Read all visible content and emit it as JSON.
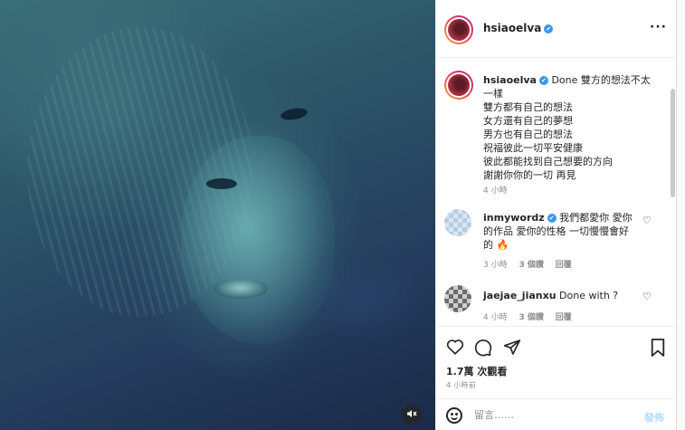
{
  "post": {
    "username": "hsiaoelva",
    "verified_mark": "✔",
    "more_label": "···"
  },
  "caption": {
    "username": "hsiaoelva",
    "first_line": "Done 雙方的想法不太一樣",
    "lines": [
      "雙方都有自己的想法",
      "女方還有自己的夢想",
      "男方也有自己的想法",
      "祝福彼此一切平安健康",
      "彼此都能找到自己想要的方向",
      "謝謝你你的一切 再見"
    ],
    "time": "4 小時"
  },
  "comments": [
    {
      "username": "inmywordz",
      "verified": true,
      "text": "我們都愛你 愛你的作品 愛你的性格 一切慢慢會好的",
      "emoji": "🔥",
      "time": "3 小時",
      "likes": "3 個讚",
      "reply": "回覆"
    },
    {
      "username": "jaejae_jianxu",
      "verified": false,
      "text": "Done with ?",
      "time": "4 小時",
      "likes": "3 個讚",
      "reply": "回覆"
    }
  ],
  "actions": {
    "like_icon": "heart-outline",
    "comment_icon": "speech-bubble",
    "share_icon": "paper-plane",
    "save_icon": "bookmark"
  },
  "views": "1.7萬 次觀看",
  "posted_time": "4 小時前",
  "add_comment": {
    "placeholder": "留言……",
    "post_label": "發佈"
  },
  "media": {
    "mute_icon": "muted-speaker"
  },
  "colors": {
    "link_blue": "#3897f0",
    "post_button_disabled": "#b3dbff",
    "secondary_text": "#8e8e8e"
  }
}
